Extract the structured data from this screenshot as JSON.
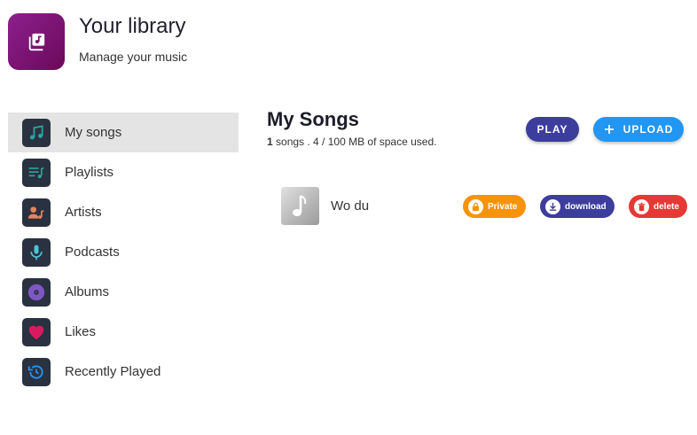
{
  "header": {
    "title": "Your library",
    "subtitle": "Manage your music",
    "logo_icon": "music-library-icon",
    "logo_color": "#7b1470"
  },
  "sidebar": {
    "active_index": 0,
    "items": [
      {
        "label": "My songs",
        "icon": "music-note-icon",
        "icon_color": "#26a69a"
      },
      {
        "label": "Playlists",
        "icon": "playlist-icon",
        "icon_color": "#26a69a"
      },
      {
        "label": "Artists",
        "icon": "artist-icon",
        "icon_color": "#e8845a"
      },
      {
        "label": "Podcasts",
        "icon": "microphone-icon",
        "icon_color": "#4dc3d6"
      },
      {
        "label": "Albums",
        "icon": "album-icon",
        "icon_color": "#7e57c2"
      },
      {
        "label": "Likes",
        "icon": "heart-icon",
        "icon_color": "#d81b60"
      },
      {
        "label": "Recently Played",
        "icon": "history-icon",
        "icon_color": "#2196f3"
      }
    ]
  },
  "main": {
    "title": "My Songs",
    "song_count": "1",
    "usage_text": " songs . 4 / 100 MB of space used.",
    "play_label": "PLAY",
    "upload_label": "UPLOAD",
    "upload_icon": "plus-icon",
    "songs": [
      {
        "name": "Wo du",
        "cover_icon": "music-note-icon",
        "privacy_label": "Private",
        "privacy_icon": "lock-icon",
        "download_label": "download",
        "download_icon": "download-icon",
        "delete_label": "delete",
        "delete_icon": "trash-icon"
      }
    ]
  },
  "colors": {
    "play": "#3d3d9e",
    "upload": "#2196f3",
    "private": "#f7930a",
    "download": "#3d3d9e",
    "delete": "#e53935",
    "sidebar_active": "#e4e4e4",
    "icon_tile": "#2a3140"
  }
}
